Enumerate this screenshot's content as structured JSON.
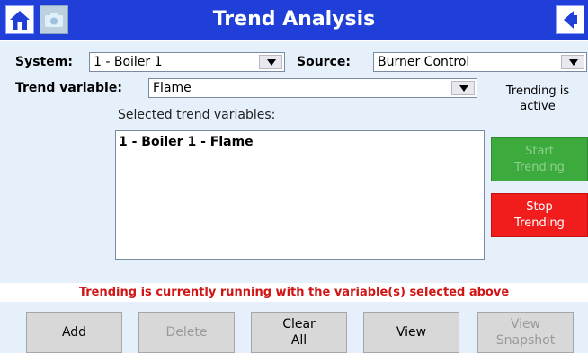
{
  "header": {
    "title": "Trend Analysis"
  },
  "system": {
    "label": "System:",
    "value": "1 - Boiler 1"
  },
  "source": {
    "label": "Source:",
    "value": "Burner Control"
  },
  "trend_variable": {
    "label": "Trend variable:",
    "value": "Flame"
  },
  "status": {
    "line1": "Trending is",
    "line2": "active"
  },
  "selected": {
    "caption": "Selected trend variables:",
    "items": [
      "1 - Boiler 1 - Flame"
    ]
  },
  "side_buttons": {
    "start_line1": "Start",
    "start_line2": "Trending",
    "stop_line1": "Stop",
    "stop_line2": "Trending"
  },
  "message": "Trending is currently running with the variable(s) selected above",
  "bottom_buttons": {
    "add": "Add",
    "delete": "Delete",
    "clear_line1": "Clear",
    "clear_line2": "All",
    "view": "View",
    "snapshot_line1": "View",
    "snapshot_line2": "Snapshot"
  },
  "icons": {
    "home": "home-icon",
    "camera": "camera-icon",
    "back": "back-arrow-icon"
  },
  "colors": {
    "titlebar": "#1f3fd8",
    "panel": "#e6f0fb",
    "start_button": "#3caa3c",
    "stop_button": "#f11c1c",
    "message_text": "#d11414"
  }
}
